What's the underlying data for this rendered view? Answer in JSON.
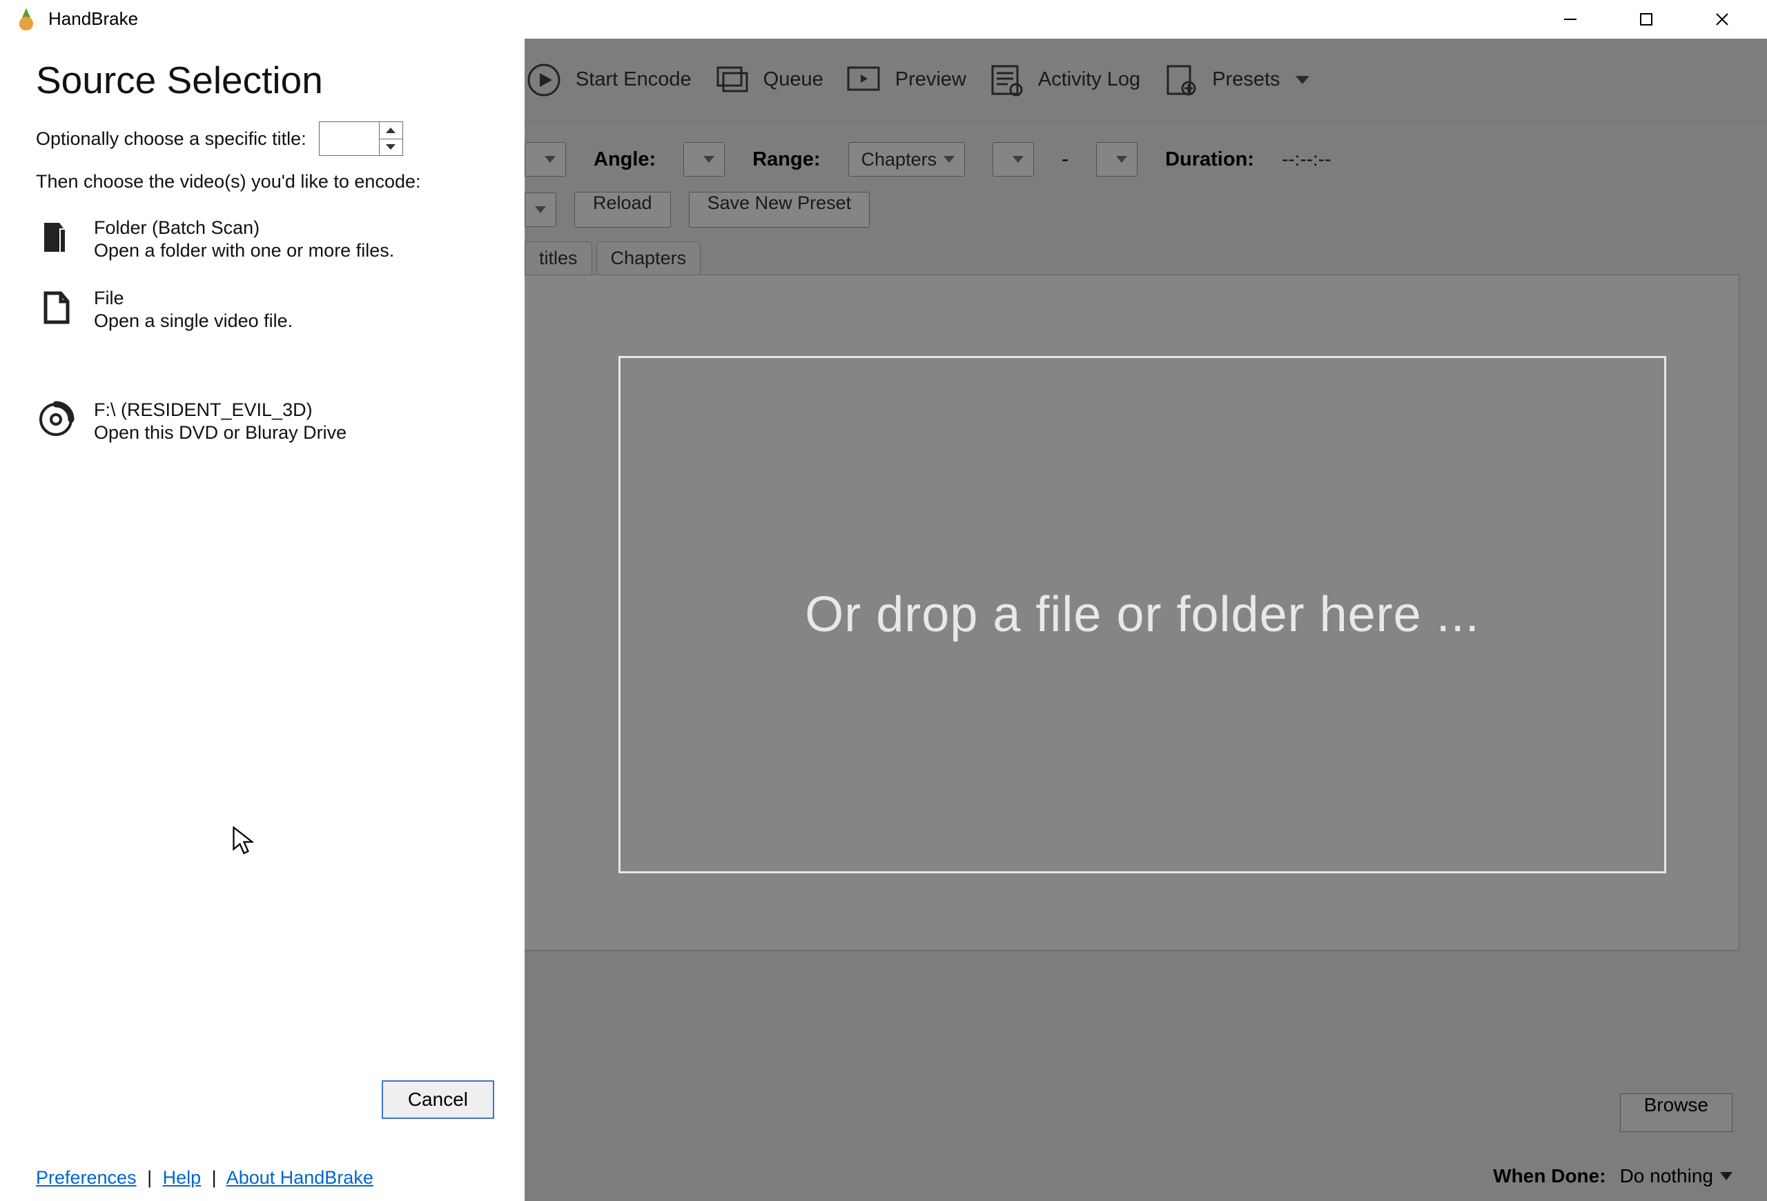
{
  "window": {
    "title": "HandBrake"
  },
  "toolbar": {
    "start_encode": "Start Encode",
    "queue": "Queue",
    "preview": "Preview",
    "activity_log": "Activity Log",
    "presets": "Presets"
  },
  "source_row": {
    "angle_label": "Angle:",
    "range_label": "Range:",
    "range_value": "Chapters",
    "range_sep": "-",
    "duration_label": "Duration:",
    "duration_value": "--:--:--"
  },
  "preset_row": {
    "reload": "Reload",
    "save_new": "Save New Preset"
  },
  "tabs": {
    "titles": "titles",
    "chapters": "Chapters"
  },
  "bottom": {
    "browse": "Browse",
    "when_done_label": "When Done:",
    "when_done_value": "Do nothing"
  },
  "dropzone": {
    "text": "Or drop a file or folder here ..."
  },
  "panel": {
    "heading": "Source Selection",
    "title_label": "Optionally choose a specific title:",
    "hint": "Then choose the video(s) you'd like to encode:",
    "folder": {
      "title": "Folder (Batch Scan)",
      "sub": "Open a folder with one or more files."
    },
    "file": {
      "title": "File",
      "sub": "Open a single video file."
    },
    "disc": {
      "title": "F:\\ (RESIDENT_EVIL_3D)",
      "sub": "Open this DVD or Bluray Drive"
    },
    "cancel": "Cancel",
    "links": {
      "prefs": "Preferences",
      "help": "Help",
      "about": "About HandBrake"
    }
  }
}
